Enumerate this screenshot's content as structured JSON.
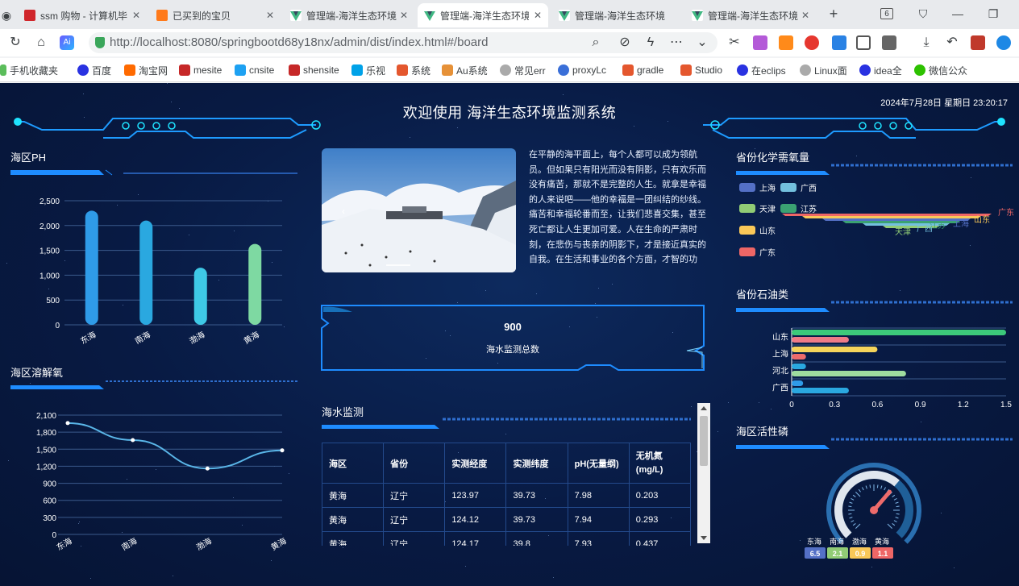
{
  "browser": {
    "tabs": [
      {
        "title": "ssm 购物 - 计算机毕",
        "icon": "ssm-favicon",
        "active": false
      },
      {
        "title": "已买到的宝贝",
        "icon": "taobao-favicon",
        "active": false
      },
      {
        "title": "管理端-海洋生态环境",
        "icon": "vue-favicon",
        "active": false
      },
      {
        "title": "管理端-海洋生态环境",
        "icon": "vue-favicon",
        "active": true
      },
      {
        "title": "管理端-海洋生态环境",
        "icon": "vue-favicon",
        "active": false
      },
      {
        "title": "管理端-海洋生态环境",
        "icon": "vue-favicon",
        "active": false
      }
    ],
    "tab_count_badge": "6",
    "url": "http://localhost:8080/springbootd68y18nx/admin/dist/index.html#/board",
    "bookmarks": [
      "手机收藏夹",
      "百度",
      "淘宝网",
      "mesite",
      "cnsite",
      "shensite",
      "乐视",
      "系统",
      "Au系统",
      "常见err",
      "proxyLc",
      "gradle",
      "Studio",
      "在eclips",
      "Linux面",
      "idea全",
      "微信公众"
    ]
  },
  "dashboard": {
    "title": "欢迎使用 海洋生态环境监测系统",
    "datetime": "2024年7月28日 星期日 23:20:17",
    "sections": {
      "ph": "海区PH",
      "oxygen": "海区溶解氧",
      "monitor": "海水监测",
      "cod": "省份化学需氧量",
      "oil": "省份石油类",
      "phosphorus": "海区活性磷"
    },
    "story": "在平静的海平面上，每个人都可以成为领航员。但如果只有阳光而没有阴影，只有欢乐而没有痛苦，那就不是完整的人生。就拿是幸福的人来说吧——他的幸福是一团纠结的纱线。痛苦和幸福轮番而至，让我们悲喜交集，甚至死亡都让人生更加可爱。人在生命的严肃时刻，在悲伤与丧亲的阴影下，才是接近真实的自我。在生活和事业的各个方面，才智的功",
    "kpi": {
      "value": "900",
      "label": "海水监测总数"
    },
    "table": {
      "headers": [
        "海区",
        "省份",
        "实测经度",
        "实测纬度",
        "pH(无量纲)",
        "无机氮(mg/L)"
      ],
      "rows": [
        [
          "黄海",
          "辽宁",
          "123.97",
          "39.73",
          "7.98",
          "0.203"
        ],
        [
          "黄海",
          "辽宁",
          "124.12",
          "39.73",
          "7.94",
          "0.293"
        ],
        [
          "黄海",
          "辽宁",
          "124.17",
          "39.8",
          "7.93",
          "0.437"
        ]
      ]
    }
  },
  "colors": {
    "accent": "#1e90ff",
    "cyan": "#00e5ff",
    "bg": "#081a43"
  },
  "chart_data": [
    {
      "id": "ph",
      "type": "bar",
      "title": "海区PH",
      "categories": [
        "东海",
        "南海",
        "渤海",
        "黄海"
      ],
      "values": [
        2300,
        2100,
        1150,
        1630
      ],
      "ylim": [
        0,
        2500
      ],
      "yticks": [
        "0",
        "500",
        "1,000",
        "1,500",
        "2,000",
        "2,500"
      ],
      "colors": [
        "#2f9be8",
        "#2aa8e0",
        "#3ec9e6",
        "#7ed9a2"
      ],
      "grid": true
    },
    {
      "id": "oxygen",
      "type": "line",
      "title": "海区溶解氧",
      "categories": [
        "东海",
        "南海",
        "渤海",
        "黄海"
      ],
      "values": [
        1960,
        1660,
        1160,
        1480
      ],
      "ylim": [
        0,
        2100
      ],
      "yticks": [
        "0",
        "300",
        "600",
        "900",
        "1,200",
        "1,500",
        "1,800",
        "2,100"
      ],
      "grid": true
    },
    {
      "id": "cod",
      "type": "funnel",
      "title": "省份化学需氧量",
      "legend": [
        "上海",
        "广西",
        "天津",
        "江苏",
        "山东",
        "广东"
      ],
      "slice_labels": [
        "广东",
        "山东",
        "上海",
        "江苏",
        "广西",
        "天津"
      ],
      "colors": {
        "上海": "#5470c6",
        "广西": "#73c0de",
        "天津": "#91cc75",
        "江苏": "#3ba272",
        "山东": "#fac858",
        "广东": "#ee6666"
      },
      "legend_position": "left"
    },
    {
      "id": "oil",
      "type": "bar",
      "orientation": "horizontal",
      "title": "省份石油类",
      "categories": [
        "广西",
        "河北",
        "上海",
        "山东"
      ],
      "series": [
        {
          "values": [
            0.08,
            0.1,
            0.6,
            1.5
          ],
          "colors": [
            "#2f9be8",
            "#2aa8e0",
            "#f5d45b",
            "#3cc97a"
          ]
        },
        {
          "values": [
            0.4,
            0.8,
            0.1,
            0.4
          ],
          "colors": [
            "#2aa8e0",
            "#9fdc9f",
            "#ee6b6b",
            "#ee7b86"
          ]
        }
      ],
      "xlim": [
        0,
        1.5
      ],
      "xticks": [
        "0",
        "0.3",
        "0.6",
        "0.9",
        "1.2",
        "1.5"
      ]
    },
    {
      "id": "phosphorus",
      "type": "gauge",
      "title": "海区活性磷",
      "categories": [
        "东海",
        "南海",
        "渤海",
        "黄海"
      ],
      "values": [
        "6.5",
        "2.1",
        "0.9",
        "1.1"
      ],
      "colors": [
        "#5470c6",
        "#91cc75",
        "#fac858",
        "#ee6666"
      ]
    }
  ]
}
